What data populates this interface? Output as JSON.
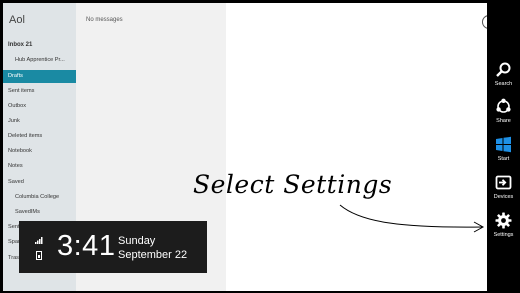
{
  "app": {
    "title": "Aol"
  },
  "folders": [
    {
      "label": "Inbox  21",
      "style": "bold"
    },
    {
      "label": "Hub Apprentice Pr...",
      "style": "sub"
    },
    {
      "label": "Drafts",
      "style": "selected"
    },
    {
      "label": "Sent items",
      "style": ""
    },
    {
      "label": "Outbox",
      "style": ""
    },
    {
      "label": "Junk",
      "style": ""
    },
    {
      "label": "Deleted items",
      "style": ""
    },
    {
      "label": "Notebook",
      "style": ""
    },
    {
      "label": "Notes",
      "style": ""
    },
    {
      "label": "Saved",
      "style": ""
    },
    {
      "label": "Columbia College",
      "style": "sub"
    },
    {
      "label": "SavedIMs",
      "style": "sub"
    },
    {
      "label": "Sent",
      "style": ""
    },
    {
      "label": "Spam",
      "style": ""
    },
    {
      "label": "Trash",
      "style": ""
    }
  ],
  "message_list": {
    "empty_text": "No messages"
  },
  "clock": {
    "time": "3:41",
    "day": "Sunday",
    "date": "September 22"
  },
  "charms": [
    {
      "label": "Search",
      "icon": "search-icon"
    },
    {
      "label": "Share",
      "icon": "share-icon"
    },
    {
      "label": "Start",
      "icon": "windows-start-icon"
    },
    {
      "label": "Devices",
      "icon": "devices-icon"
    },
    {
      "label": "Settings",
      "icon": "gear-icon"
    }
  ],
  "annotation": {
    "text": "Select Settings"
  },
  "colors": {
    "accent": "#1a8aa3",
    "sidebar": "#dfe4e7",
    "charms_bar": "#000000"
  }
}
